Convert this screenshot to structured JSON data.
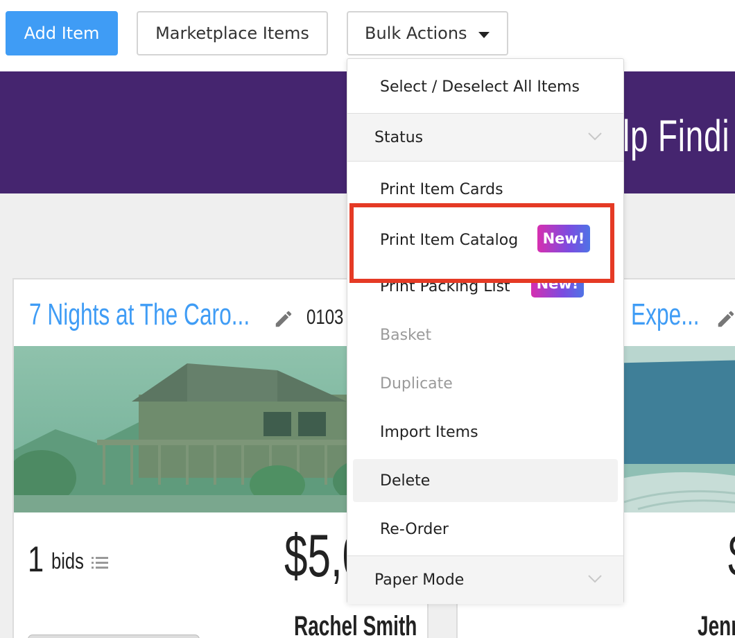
{
  "toolbar": {
    "add_item": "Add Item",
    "marketplace_items": "Marketplace Items",
    "bulk_actions": "Bulk Actions"
  },
  "banner": {
    "title_fragment": "lp Findi"
  },
  "cards": [
    {
      "title": "7 Nights at The Caro...",
      "item_number": "0103",
      "bids_count": "1",
      "bids_label": "bids",
      "price": "$5,0",
      "bidder": "Rachel Smith"
    },
    {
      "title": "Expe...",
      "price": "$",
      "bidder": "Jenn"
    }
  ],
  "menu": {
    "select_all": "Select / Deselect All Items",
    "status_section": "Status",
    "print_item_cards": "Print Item Cards",
    "print_item_catalog": "Print Item Catalog",
    "print_packing_list": "Print Packing List",
    "new_badge": "New!",
    "basket": "Basket",
    "duplicate": "Duplicate",
    "import_items": "Import Items",
    "delete": "Delete",
    "reorder": "Re-Order",
    "paper_mode_section": "Paper Mode"
  },
  "colors": {
    "primary": "#3f9cf5",
    "banner": "#45256f",
    "highlight": "#e53a25",
    "badge_start": "#d62fb0",
    "badge_end": "#4f73e6"
  }
}
